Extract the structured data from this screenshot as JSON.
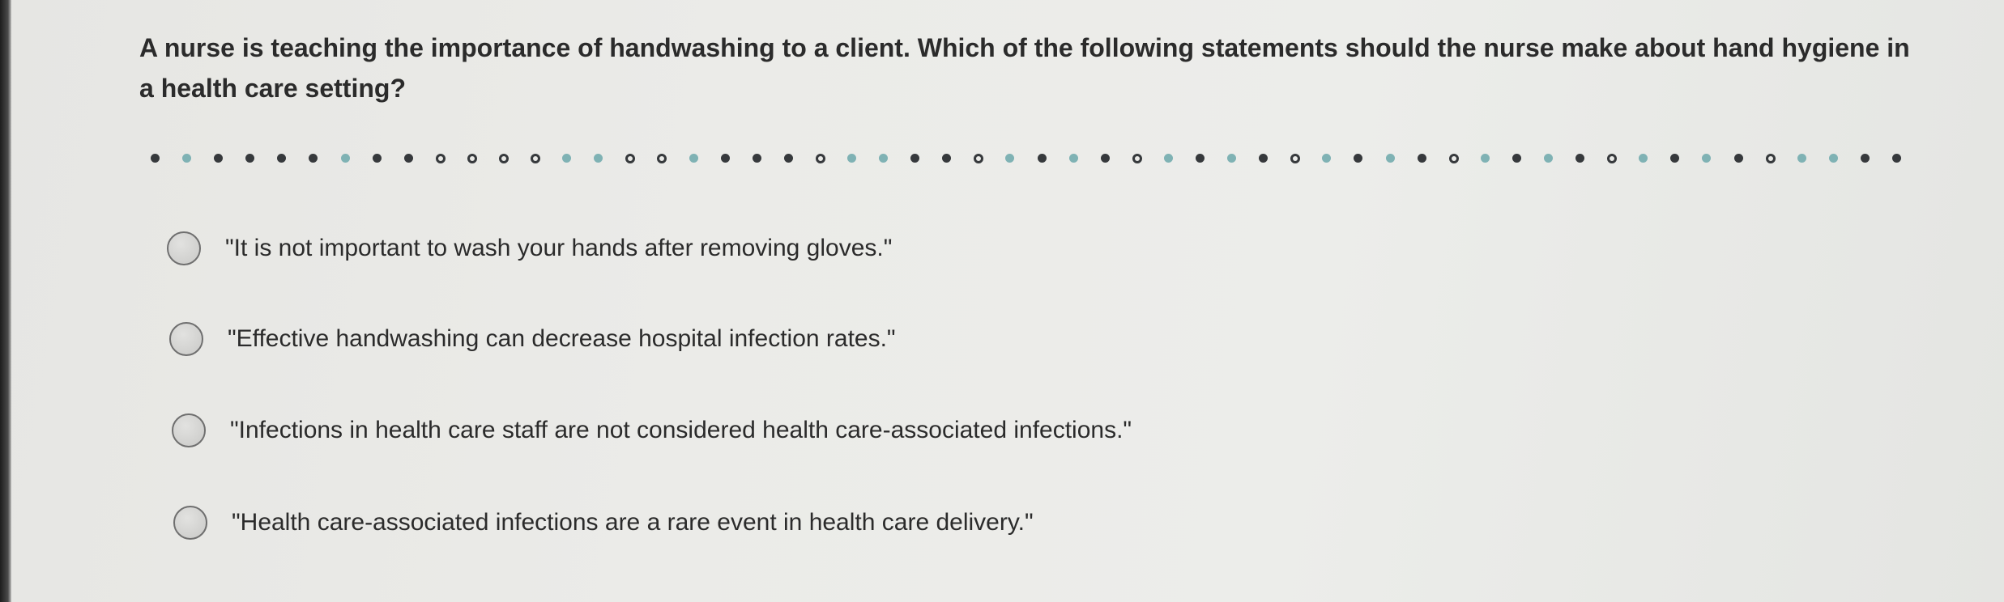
{
  "question": {
    "text": "A nurse is teaching the importance of handwashing to a client. Which of the following statements should the nurse make about hand hygiene in a health care setting?"
  },
  "options": [
    {
      "label": "\"It is not important to wash your hands after removing gloves.\""
    },
    {
      "label": "\"Effective handwashing can decrease hospital infection rates.\""
    },
    {
      "label": "\"Infections in health care staff are not considered health care-associated infections.\""
    },
    {
      "label": "\"Health care-associated infections are a rare event in health care delivery.\""
    }
  ],
  "separator": {
    "pattern": [
      "d",
      "t",
      "d",
      "d",
      "d",
      "d",
      "t",
      "d",
      "d",
      "o",
      "o",
      "o",
      "o",
      "t",
      "t",
      "o",
      "o",
      "t",
      "d",
      "d",
      "d",
      "o",
      "t",
      "t",
      "d",
      "d",
      "o",
      "t",
      "d",
      "t",
      "d",
      "o",
      "t",
      "d",
      "t",
      "d",
      "o",
      "t",
      "d",
      "t",
      "d",
      "o",
      "t",
      "d",
      "t",
      "d",
      "o",
      "t",
      "d",
      "t",
      "d",
      "o",
      "t",
      "t",
      "d",
      "d"
    ],
    "colors": {
      "dark": "#36393c",
      "teal": "#7fb2b4"
    }
  }
}
